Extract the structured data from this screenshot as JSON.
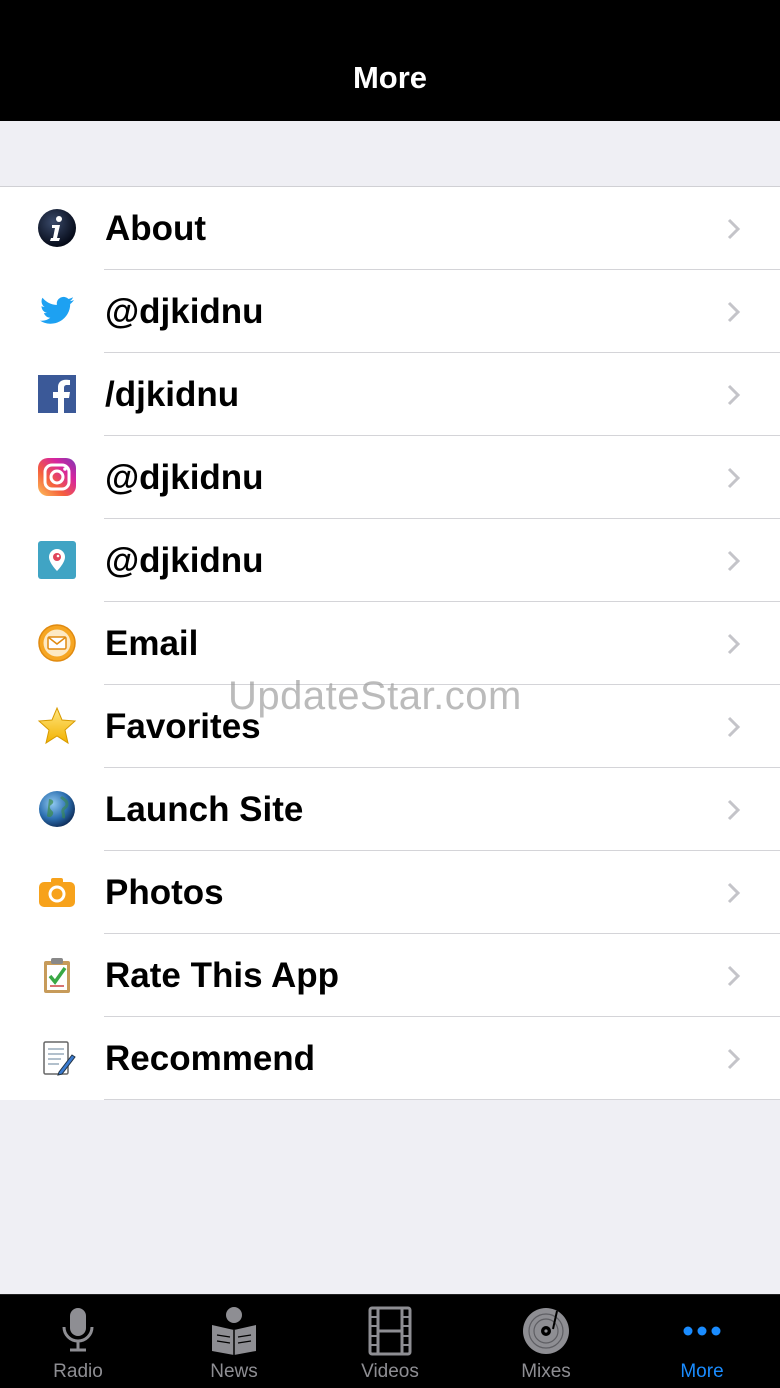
{
  "header": {
    "title": "More"
  },
  "menu": {
    "items": [
      {
        "label": "About",
        "icon": "info-icon"
      },
      {
        "label": "@djkidnu",
        "icon": "twitter-icon"
      },
      {
        "label": "/djkidnu",
        "icon": "facebook-icon"
      },
      {
        "label": "@djkidnu",
        "icon": "instagram-icon"
      },
      {
        "label": "@djkidnu",
        "icon": "periscope-icon"
      },
      {
        "label": "Email",
        "icon": "email-icon"
      },
      {
        "label": "Favorites",
        "icon": "star-icon"
      },
      {
        "label": "Launch Site",
        "icon": "globe-icon"
      },
      {
        "label": "Photos",
        "icon": "camera-icon"
      },
      {
        "label": "Rate This App",
        "icon": "clipboard-check-icon"
      },
      {
        "label": "Recommend",
        "icon": "notepad-pencil-icon"
      }
    ]
  },
  "watermark": "UpdateStar.com",
  "tabbar": {
    "tabs": [
      {
        "label": "Radio",
        "icon": "microphone-icon"
      },
      {
        "label": "News",
        "icon": "newspaper-reader-icon"
      },
      {
        "label": "Videos",
        "icon": "film-strip-icon"
      },
      {
        "label": "Mixes",
        "icon": "vinyl-disc-icon"
      },
      {
        "label": "More",
        "icon": "more-dots-icon"
      }
    ],
    "active": "More",
    "active_color": "#1a8cff",
    "inactive_color": "#8e8e93"
  }
}
